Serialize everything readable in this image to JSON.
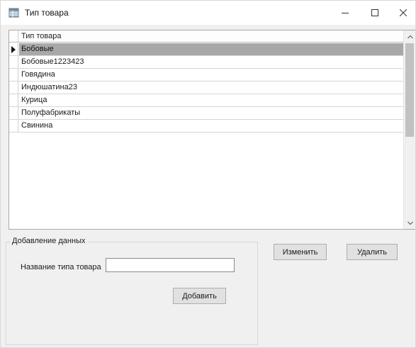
{
  "window": {
    "title": "Тип товара",
    "icon": "database-table-icon"
  },
  "grid": {
    "column_header": "Тип товара",
    "rows": [
      {
        "value": "Бобовые",
        "selected": true
      },
      {
        "value": "Бобовые1223423",
        "selected": false
      },
      {
        "value": "Говядина",
        "selected": false
      },
      {
        "value": "Индюшатина23",
        "selected": false
      },
      {
        "value": "Курица",
        "selected": false
      },
      {
        "value": "Полуфабрикаты",
        "selected": false
      },
      {
        "value": "Свинина",
        "selected": false
      }
    ],
    "selection_color": "#a8a8a8"
  },
  "add_group": {
    "title": "Добавление данных",
    "field_label": "Название типа товара",
    "field_value": "",
    "add_button": "Добавить"
  },
  "actions": {
    "edit_button": "Изменить",
    "delete_button": "Удалить"
  }
}
